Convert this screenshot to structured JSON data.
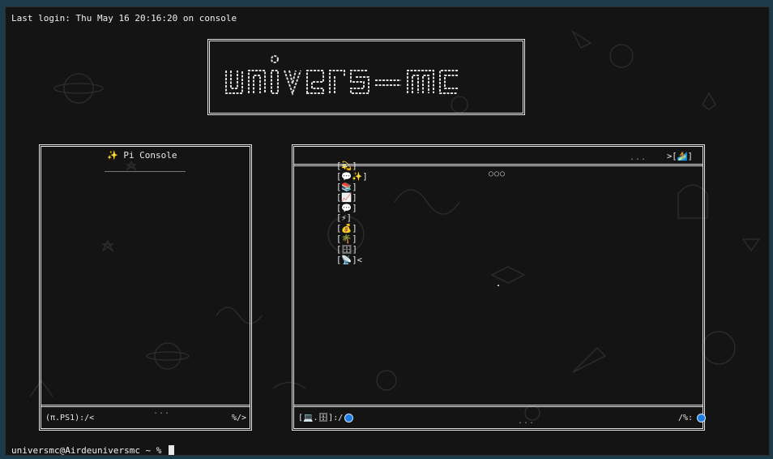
{
  "terminal": {
    "last_login": "Last login: Thu May 16 20:16:20 on console",
    "prompt": "universmc@Airdeuniversmc ~ % ",
    "bottom_dots": "..."
  },
  "logo": {
    "text": "univers-mc"
  },
  "pi_console": {
    "title": "✨ Pi Console",
    "footer_left": "(π.PS1):/<",
    "footer_dots": "...",
    "footer_right": "%/>"
  },
  "main_console": {
    "toolbar_items": [
      "[💫]",
      "[💬✨]",
      "[📚]",
      "[📈]",
      "[💬]",
      "[⚡]",
      "[💰]",
      "[🌴]",
      "[🗄]",
      "[📡]<"
    ],
    "toolbar_dots": "...",
    "toolbar_right": ">[🏄]",
    "top_indicator": "○○○",
    "footer_left": "[💻.🗄]:/",
    "footer_dots": "...",
    "footer_right": "/%:"
  },
  "colors": {
    "background": "#141414",
    "frame": "#e4e4e4",
    "accent_dot": "#1d7de0",
    "desktop": "#1b3a4a"
  }
}
